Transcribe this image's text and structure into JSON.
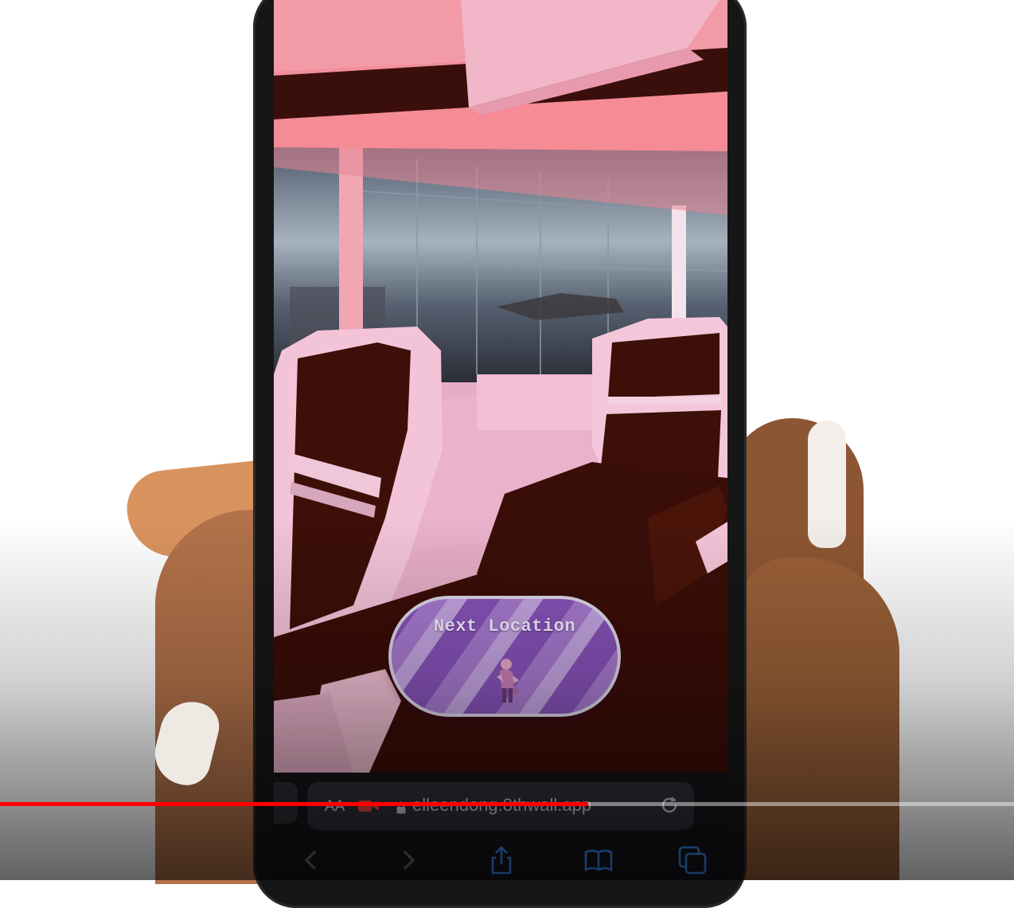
{
  "ar_view": {
    "button_label": "Next Location"
  },
  "browser": {
    "text_size_label": "AA",
    "url": "elleendong.8thwall.app"
  },
  "toolbar": {
    "icons": [
      "back-icon",
      "forward-icon",
      "share-icon",
      "bookmarks-icon",
      "tabs-icon"
    ]
  },
  "player": {
    "progress_fraction": 0.58
  },
  "colors": {
    "accent_purple": "#8752b9",
    "scene_pink": "#e6aec6",
    "seat_brown": "#3b1008",
    "progress_red": "#ff0000"
  }
}
